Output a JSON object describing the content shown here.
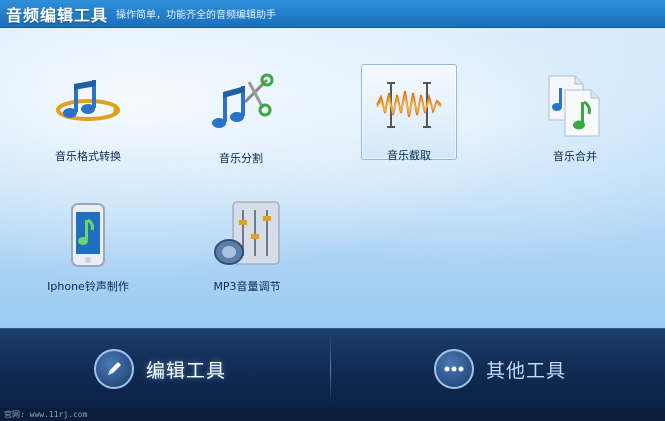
{
  "app": {
    "title": "音频编辑工具",
    "subtitle": "操作简单，功能齐全的音频编辑助手"
  },
  "tools": [
    {
      "label": "音乐格式转换",
      "icon": "music-convert-icon",
      "selected": false
    },
    {
      "label": "音乐分割",
      "icon": "music-scissors-icon",
      "selected": false
    },
    {
      "label": "音乐截取",
      "icon": "waveform-clip-icon",
      "selected": true
    },
    {
      "label": "音乐合并",
      "icon": "music-merge-icon",
      "selected": false
    },
    {
      "label": "Iphone铃声制作",
      "icon": "phone-ringtone-icon",
      "selected": false
    },
    {
      "label": "MP3音量调节",
      "icon": "volume-mixer-icon",
      "selected": false
    }
  ],
  "bottom_tabs": {
    "edit_label": "编辑工具",
    "other_label": "其他工具"
  },
  "status": {
    "site": "官网: www.11rj.com"
  },
  "colors": {
    "accent": "#2f8fd8",
    "note_blue": "#2a73c9",
    "note_green": "#3aa843",
    "bottom_bar": "#102a52"
  }
}
